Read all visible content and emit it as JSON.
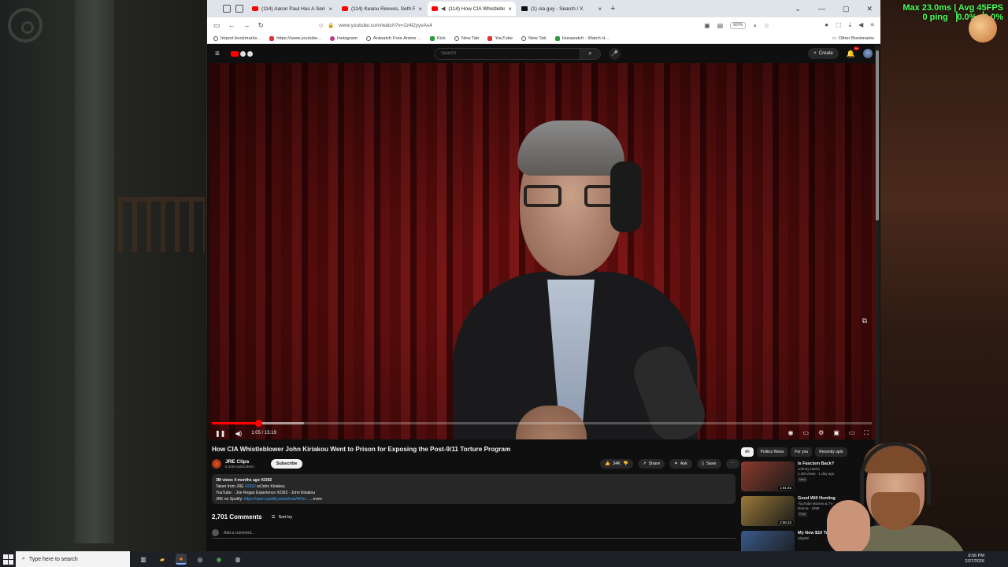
{
  "overlay": {
    "fps_line1": "Max 23.0ms | Avg 45FPS",
    "fps_line2": "0 ping ▕0.0%▕0.0%"
  },
  "browser": {
    "tabs": [
      {
        "title": "(114) Aaron Paul Has A Serious",
        "favicon": "youtube-icon",
        "active": false
      },
      {
        "title": "(114) Keanu Reeves, Seth Roge",
        "favicon": "youtube-icon",
        "active": false
      },
      {
        "title": "(114) How CIA Whistleblo",
        "favicon": "youtube-icon",
        "active": true
      },
      {
        "title": "(1) cia guy - Search / X",
        "favicon": "x-icon",
        "active": false
      }
    ],
    "url": "www.youtube.com/watch?v=2z4l2yyvAs4",
    "zoom": "60%",
    "bookmarks": [
      "Import bookmarks...",
      "https://www.youtube...",
      "Instagram",
      "Aniwatch Free Anime ...",
      "Kick",
      "New Tab",
      "YouTube",
      "New Tab",
      "Hurawatch - Watch H..."
    ],
    "other_bookmarks": "Other Bookmarks"
  },
  "youtube": {
    "search_placeholder": "Search",
    "create_label": "Create",
    "notif_count": "9+",
    "player": {
      "current_time": "1:05",
      "duration": "15:19",
      "time_text": "1:05 / 15:19",
      "progress_fraction": 0.071,
      "buffered_fraction": 0.14
    },
    "video": {
      "title": "How CIA Whistleblower John Kiriakou Went to Prison for Exposing the Post-9/11 Torture Program",
      "channel": "JRE Clips",
      "subscribers": "6.34M subscribers",
      "subscribe_label": "Subscribe",
      "likes": "34K",
      "share_label": "Share",
      "ask_label": "Ask",
      "save_label": "Save"
    },
    "description": {
      "meta": "3M views  4 months ago  #2392",
      "line1_prefix": "Taken from JRE ",
      "line1_link": "#2392",
      "line1_suffix": " w/John Kiriakou",
      "line2": "YouTube:  · Joe Rogan Experience #2392 - John Kiriakou",
      "line3_prefix": "JRE on Spotify: ",
      "line3_link": "https://open.spotify.com/show/4rOo...",
      "more": "...more"
    },
    "comments": {
      "count": "2,701 Comments",
      "sort_label": "Sort by",
      "add_placeholder": "Add a comment..."
    },
    "chips": [
      "All",
      "Politics News",
      "For you",
      "Recently uplo"
    ],
    "related": [
      {
        "title": "Is Fascism Back?",
        "channel": "Johnny Harris",
        "meta": "1.4M views · 1 day ago",
        "badge": "New",
        "duration": "1:01:46",
        "color": "#8a3a2c"
      },
      {
        "title": "Good Will Hunting",
        "channel": "YouTube Movies & TV",
        "meta": "Drama · 1998",
        "badge": "Free",
        "duration": "2:06:33",
        "color": "#9a7a3a"
      },
      {
        "title": "My New $10 Tour!",
        "channel": "SlapWi",
        "meta": "",
        "badge": "",
        "duration": "",
        "color": "#3a5a8a"
      }
    ]
  },
  "taskbar": {
    "search_placeholder": "Type here to search",
    "time": "8:56 PM",
    "date": "2/27/2026"
  }
}
